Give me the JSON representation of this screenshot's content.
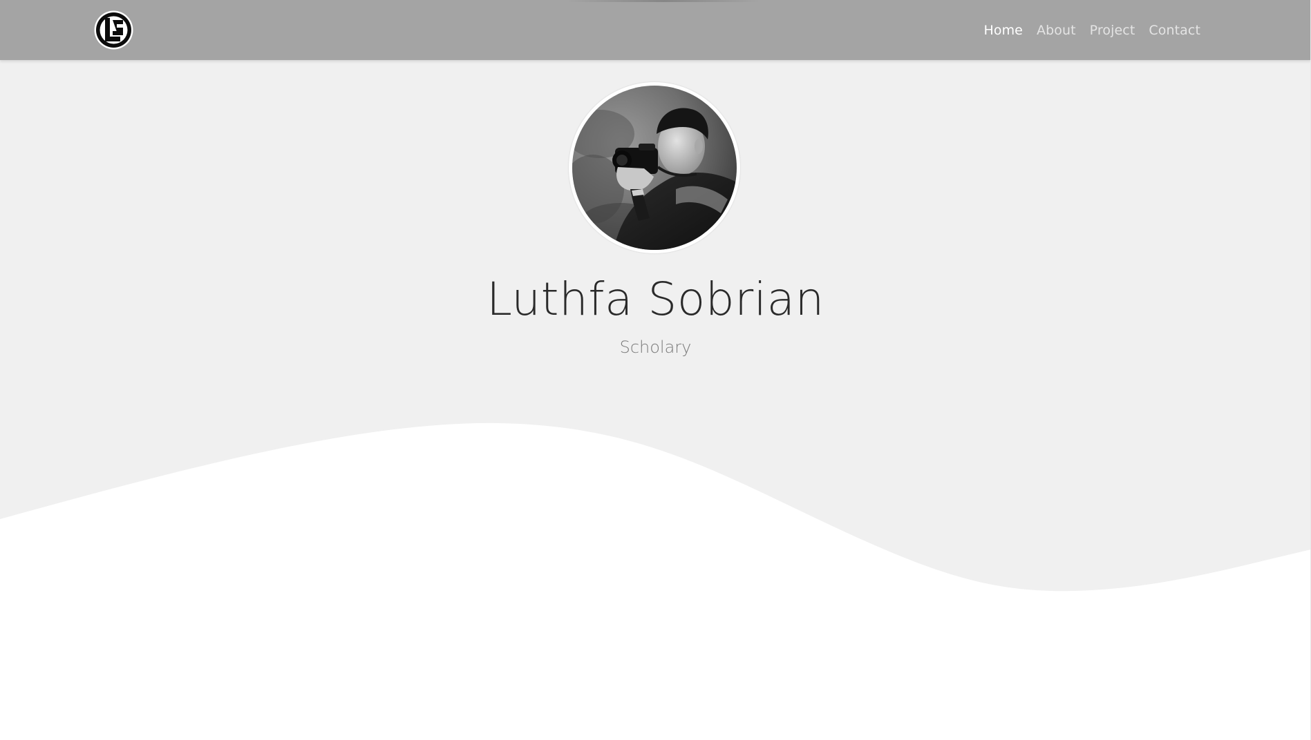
{
  "navbar": {
    "logo_icon": "luthfa-logo-icon",
    "links": [
      {
        "label": "Home",
        "active": true
      },
      {
        "label": "About",
        "active": false
      },
      {
        "label": "Project",
        "active": false
      },
      {
        "label": "Contact",
        "active": false
      }
    ],
    "background": "#a4a4a4"
  },
  "hero": {
    "name": "Luthfa Sobrian",
    "subtitle": "Scholary",
    "avatar_icon": "profile-photo-photographer",
    "background": "#f0f0f0",
    "wave_color": "#ffffff"
  }
}
